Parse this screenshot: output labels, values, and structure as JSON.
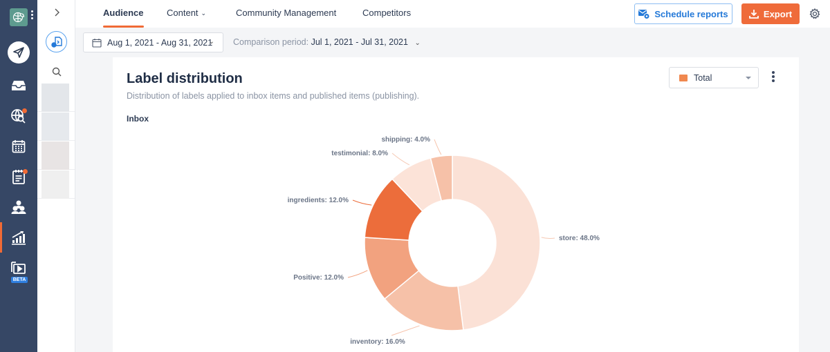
{
  "leftnav": {
    "items": [
      {
        "name": "compose",
        "icon": "paper-plane-icon"
      },
      {
        "name": "inbox",
        "icon": "inbox-tray-icon"
      },
      {
        "name": "listening",
        "icon": "globe-search-icon",
        "badge": true
      },
      {
        "name": "calendar",
        "icon": "calendar-icon"
      },
      {
        "name": "tasks",
        "icon": "clipboard-icon",
        "badge": true
      },
      {
        "name": "people",
        "icon": "people-icon"
      },
      {
        "name": "analytics",
        "icon": "analytics-chart-icon",
        "active": true
      },
      {
        "name": "video",
        "icon": "video-library-icon",
        "badge_text": "BETA"
      }
    ]
  },
  "tabs": [
    {
      "label": "Audience",
      "active": true
    },
    {
      "label": "Content",
      "dropdown": true
    },
    {
      "label": "Community Management"
    },
    {
      "label": "Competitors"
    }
  ],
  "toolbar": {
    "schedule_label": "Schedule reports",
    "export_label": "Export"
  },
  "filters": {
    "date_range": "Aug 1, 2021 - Aug 31, 2021",
    "comparison_label": "Comparison period:",
    "comparison_range": "Jul 1, 2021 - Jul 31, 2021"
  },
  "card": {
    "title": "Label distribution",
    "subtitle": "Distribution of labels applied to inbox items and published items (publishing).",
    "section": "Inbox",
    "metric_select": "Total"
  },
  "colors": {
    "accent": "#ef6b3a",
    "primary_blue": "#2479d8",
    "nav_bg": "#364765"
  },
  "chart_data": {
    "type": "pie",
    "subtype": "donut",
    "title": "Inbox",
    "start": "top",
    "direction": "clockwise",
    "slices": [
      {
        "label": "store",
        "value": 48.0,
        "display": "store: 48.0%",
        "color": "#fbe1d6"
      },
      {
        "label": "inventory",
        "value": 16.0,
        "display": "inventory: 16.0%",
        "color": "#f6c1a8"
      },
      {
        "label": "Positive",
        "value": 12.0,
        "display": "Positive: 12.0%",
        "color": "#f2a27f"
      },
      {
        "label": "ingredients",
        "value": 12.0,
        "display": "ingredients: 12.0%",
        "color": "#ec6d3b"
      },
      {
        "label": "testimonial",
        "value": 8.0,
        "display": "testimonial: 8.0%",
        "color": "#fce3d8"
      },
      {
        "label": "shipping",
        "value": 4.0,
        "display": "shipping: 4.0%",
        "color": "#f6c1a8"
      }
    ]
  }
}
